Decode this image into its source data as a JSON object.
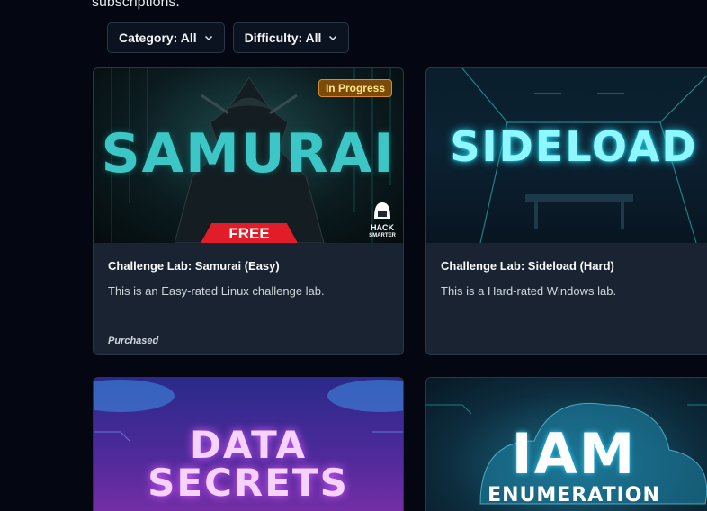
{
  "intro": {
    "text": "subscriptions."
  },
  "filters": {
    "category_label": "Category: All",
    "difficulty_label": "Difficulty: All"
  },
  "cards": [
    {
      "badge": "In Progress",
      "image_text": "SAMURAI",
      "ribbon": "FREE",
      "logo_line1": "HACK",
      "logo_line2": "SMARTER",
      "title": "Challenge Lab: Samurai (Easy)",
      "description": "This is an Easy-rated Linux challenge lab.",
      "status": "Purchased"
    },
    {
      "image_text": "SIDELOAD",
      "title": "Challenge Lab: Sideload (Hard)",
      "description": "This is a Hard-rated Windows lab."
    },
    {
      "image_text_line1": "DATA",
      "image_text_line2": "SECRETS"
    },
    {
      "image_text_line1": "IAM",
      "image_text_line2": "ENUMERATION"
    }
  ],
  "colors": {
    "page_bg": "#040712",
    "card_bg": "#1a2332",
    "badge_bg": "#7c4a0a",
    "ribbon_red": "#e11d2a",
    "teal": "#2fd3d6"
  }
}
